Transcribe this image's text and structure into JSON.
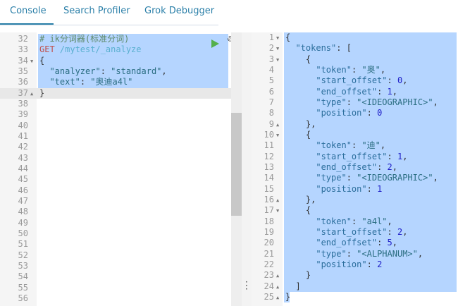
{
  "tabs": [
    {
      "label": "Console"
    },
    {
      "label": "Search Profiler"
    },
    {
      "label": "Grok Debugger"
    }
  ],
  "request": {
    "lines": [
      {
        "n": "32",
        "fold": "",
        "seg": [
          [
            "c",
            "# ik分词器(标准分词)"
          ]
        ]
      },
      {
        "n": "33",
        "fold": "",
        "seg": [
          [
            "m",
            "GET "
          ],
          [
            "u",
            "/mytest/_analyze"
          ]
        ]
      },
      {
        "n": "34",
        "fold": "▼",
        "seg": [
          [
            "p",
            "{"
          ]
        ]
      },
      {
        "n": "35",
        "fold": "",
        "seg": [
          [
            "p",
            "  "
          ],
          [
            "s",
            "\"analyzer\""
          ],
          [
            "p",
            ": "
          ],
          [
            "s",
            "\"standard\""
          ],
          [
            "p",
            ","
          ]
        ]
      },
      {
        "n": "36",
        "fold": "",
        "seg": [
          [
            "p",
            "  "
          ],
          [
            "s",
            "\"text\""
          ],
          [
            "p",
            ": "
          ],
          [
            "s",
            "\"奥迪a4l\""
          ]
        ]
      },
      {
        "n": "37",
        "fold": "▲",
        "seg": [
          [
            "p",
            "}"
          ]
        ]
      },
      {
        "n": "38",
        "fold": "",
        "seg": []
      },
      {
        "n": "39",
        "fold": "",
        "seg": []
      },
      {
        "n": "40",
        "fold": "",
        "seg": []
      },
      {
        "n": "41",
        "fold": "",
        "seg": []
      },
      {
        "n": "42",
        "fold": "",
        "seg": []
      },
      {
        "n": "43",
        "fold": "",
        "seg": []
      },
      {
        "n": "44",
        "fold": "",
        "seg": []
      },
      {
        "n": "45",
        "fold": "",
        "seg": []
      },
      {
        "n": "46",
        "fold": "",
        "seg": []
      },
      {
        "n": "47",
        "fold": "",
        "seg": []
      },
      {
        "n": "48",
        "fold": "",
        "seg": []
      },
      {
        "n": "49",
        "fold": "",
        "seg": []
      },
      {
        "n": "50",
        "fold": "",
        "seg": []
      },
      {
        "n": "51",
        "fold": "",
        "seg": []
      },
      {
        "n": "52",
        "fold": "",
        "seg": []
      },
      {
        "n": "53",
        "fold": "",
        "seg": []
      },
      {
        "n": "54",
        "fold": "",
        "seg": []
      },
      {
        "n": "55",
        "fold": "",
        "seg": []
      },
      {
        "n": "56",
        "fold": "",
        "seg": []
      }
    ]
  },
  "response": {
    "lines": [
      {
        "n": "1",
        "fold": "▼",
        "seg": [
          [
            "p",
            "{"
          ]
        ]
      },
      {
        "n": "2",
        "fold": "▼",
        "seg": [
          [
            "p",
            "  "
          ],
          [
            "k",
            "\"tokens\""
          ],
          [
            "p",
            ": ["
          ]
        ]
      },
      {
        "n": "3",
        "fold": "▼",
        "seg": [
          [
            "p",
            "    {"
          ]
        ]
      },
      {
        "n": "4",
        "fold": "",
        "seg": [
          [
            "p",
            "      "
          ],
          [
            "k",
            "\"token\""
          ],
          [
            "p",
            ": "
          ],
          [
            "s",
            "\"奥\""
          ],
          [
            "p",
            ","
          ]
        ]
      },
      {
        "n": "5",
        "fold": "",
        "seg": [
          [
            "p",
            "      "
          ],
          [
            "k",
            "\"start_offset\""
          ],
          [
            "p",
            ": "
          ],
          [
            "n",
            "0"
          ],
          [
            "p",
            ","
          ]
        ]
      },
      {
        "n": "6",
        "fold": "",
        "seg": [
          [
            "p",
            "      "
          ],
          [
            "k",
            "\"end_offset\""
          ],
          [
            "p",
            ": "
          ],
          [
            "n",
            "1"
          ],
          [
            "p",
            ","
          ]
        ]
      },
      {
        "n": "7",
        "fold": "",
        "seg": [
          [
            "p",
            "      "
          ],
          [
            "k",
            "\"type\""
          ],
          [
            "p",
            ": "
          ],
          [
            "s",
            "\"<IDEOGRAPHIC>\""
          ],
          [
            "p",
            ","
          ]
        ]
      },
      {
        "n": "8",
        "fold": "",
        "seg": [
          [
            "p",
            "      "
          ],
          [
            "k",
            "\"position\""
          ],
          [
            "p",
            ": "
          ],
          [
            "n",
            "0"
          ]
        ]
      },
      {
        "n": "9",
        "fold": "▲",
        "seg": [
          [
            "p",
            "    },"
          ]
        ]
      },
      {
        "n": "10",
        "fold": "▼",
        "seg": [
          [
            "p",
            "    {"
          ]
        ]
      },
      {
        "n": "11",
        "fold": "",
        "seg": [
          [
            "p",
            "      "
          ],
          [
            "k",
            "\"token\""
          ],
          [
            "p",
            ": "
          ],
          [
            "s",
            "\"迪\""
          ],
          [
            "p",
            ","
          ]
        ]
      },
      {
        "n": "12",
        "fold": "",
        "seg": [
          [
            "p",
            "      "
          ],
          [
            "k",
            "\"start_offset\""
          ],
          [
            "p",
            ": "
          ],
          [
            "n",
            "1"
          ],
          [
            "p",
            ","
          ]
        ]
      },
      {
        "n": "13",
        "fold": "",
        "seg": [
          [
            "p",
            "      "
          ],
          [
            "k",
            "\"end_offset\""
          ],
          [
            "p",
            ": "
          ],
          [
            "n",
            "2"
          ],
          [
            "p",
            ","
          ]
        ]
      },
      {
        "n": "14",
        "fold": "",
        "seg": [
          [
            "p",
            "      "
          ],
          [
            "k",
            "\"type\""
          ],
          [
            "p",
            ": "
          ],
          [
            "s",
            "\"<IDEOGRAPHIC>\""
          ],
          [
            "p",
            ","
          ]
        ]
      },
      {
        "n": "15",
        "fold": "",
        "seg": [
          [
            "p",
            "      "
          ],
          [
            "k",
            "\"position\""
          ],
          [
            "p",
            ": "
          ],
          [
            "n",
            "1"
          ]
        ]
      },
      {
        "n": "16",
        "fold": "▲",
        "seg": [
          [
            "p",
            "    },"
          ]
        ]
      },
      {
        "n": "17",
        "fold": "▼",
        "seg": [
          [
            "p",
            "    {"
          ]
        ]
      },
      {
        "n": "18",
        "fold": "",
        "seg": [
          [
            "p",
            "      "
          ],
          [
            "k",
            "\"token\""
          ],
          [
            "p",
            ": "
          ],
          [
            "s",
            "\"a4l\""
          ],
          [
            "p",
            ","
          ]
        ]
      },
      {
        "n": "19",
        "fold": "",
        "seg": [
          [
            "p",
            "      "
          ],
          [
            "k",
            "\"start_offset\""
          ],
          [
            "p",
            ": "
          ],
          [
            "n",
            "2"
          ],
          [
            "p",
            ","
          ]
        ]
      },
      {
        "n": "20",
        "fold": "",
        "seg": [
          [
            "p",
            "      "
          ],
          [
            "k",
            "\"end_offset\""
          ],
          [
            "p",
            ": "
          ],
          [
            "n",
            "5"
          ],
          [
            "p",
            ","
          ]
        ]
      },
      {
        "n": "21",
        "fold": "",
        "seg": [
          [
            "p",
            "      "
          ],
          [
            "k",
            "\"type\""
          ],
          [
            "p",
            ": "
          ],
          [
            "s",
            "\"<ALPHANUM>\""
          ],
          [
            "p",
            ","
          ]
        ]
      },
      {
        "n": "22",
        "fold": "",
        "seg": [
          [
            "p",
            "      "
          ],
          [
            "k",
            "\"position\""
          ],
          [
            "p",
            ": "
          ],
          [
            "n",
            "2"
          ]
        ]
      },
      {
        "n": "23",
        "fold": "▲",
        "seg": [
          [
            "p",
            "    }"
          ]
        ]
      },
      {
        "n": "24",
        "fold": "▲",
        "seg": [
          [
            "p",
            "  ]"
          ]
        ]
      },
      {
        "n": "25",
        "fold": "▲",
        "seg": [
          [
            "p",
            "}"
          ]
        ]
      }
    ]
  },
  "colors": {
    "accent": "#2a7fa8",
    "selection": "#b5d5ff",
    "run": "#54b04a"
  }
}
